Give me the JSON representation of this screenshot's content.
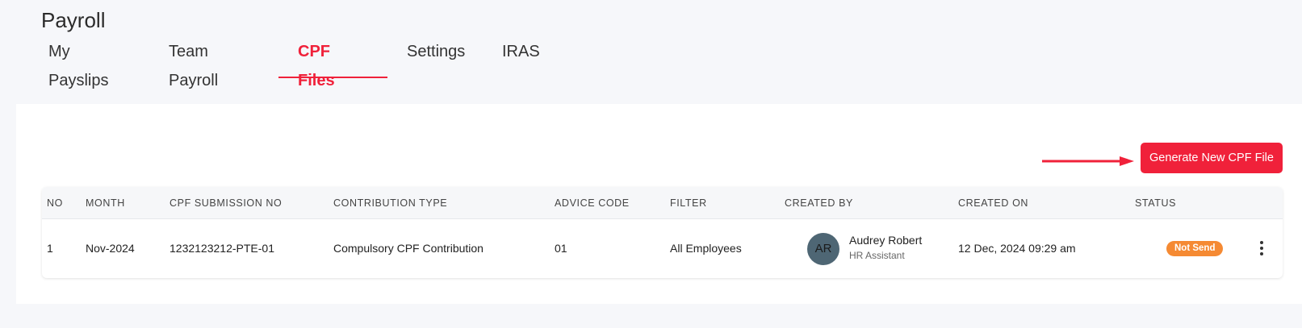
{
  "page": {
    "title": "Payroll"
  },
  "tabs": [
    {
      "label": "My Payslips",
      "active": false
    },
    {
      "label": "Team Payroll",
      "active": false
    },
    {
      "label": "CPF Files",
      "active": true
    },
    {
      "label": "Settings",
      "active": false
    },
    {
      "label": "IRAS",
      "active": false
    }
  ],
  "actions": {
    "generate_label": "Generate New CPF File"
  },
  "table": {
    "headers": [
      "NO",
      "MONTH",
      "CPF SUBMISSION NO",
      "CONTRIBUTION TYPE",
      "ADVICE CODE",
      "FILTER",
      "CREATED BY",
      "CREATED ON",
      "STATUS"
    ],
    "rows": [
      {
        "no": "1",
        "month": "Nov-2024",
        "submission_no": "1232123212-PTE-01",
        "contribution_type": "Compulsory CPF Contribution",
        "advice_code": "01",
        "filter": "All Employees",
        "created_by": {
          "initials": "AR",
          "name": "Audrey Robert",
          "role": "HR Assistant"
        },
        "created_on": "12 Dec, 2024 09:29 am",
        "status": "Not Send"
      }
    ]
  },
  "icons": {
    "row_menu": "kebab-menu-icon",
    "annotation": "arrow-right-icon"
  },
  "colors": {
    "accent": "#f0213a",
    "status_not_send": "#f58a33",
    "avatar_bg": "#4e6674"
  }
}
